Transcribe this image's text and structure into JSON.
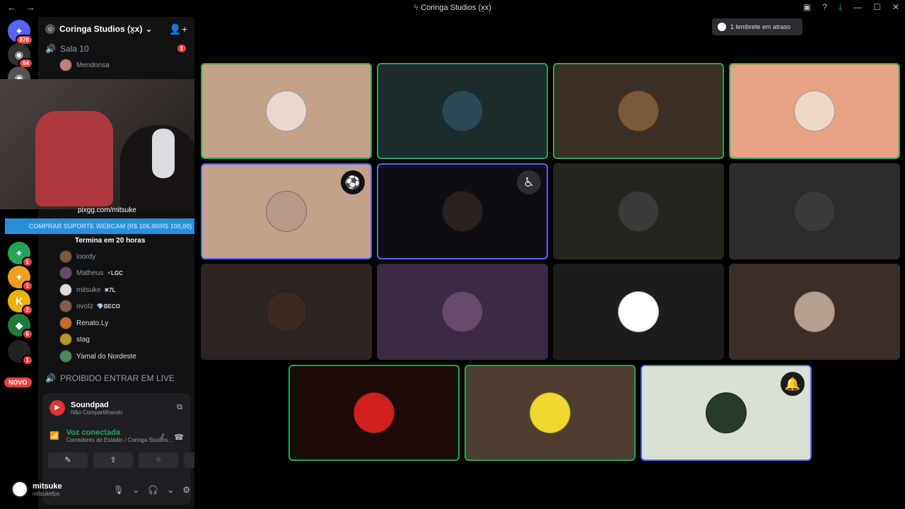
{
  "titlebar": {
    "title": "Coringa Studios (x̯x)",
    "back": "←",
    "forward": "→",
    "controls": [
      "▣",
      "?",
      "⤓",
      "—",
      "☐",
      "✕"
    ]
  },
  "servers": {
    "items": [
      {
        "icon": "discord-home-icon",
        "glyph": "✦",
        "color": "#5865f2",
        "badge": "878"
      },
      {
        "icon": "server-avatar-icon",
        "glyph": "◉",
        "color": "#333",
        "badge": "64"
      },
      {
        "icon": "server-avatar-icon",
        "glyph": "◉",
        "color": "#555",
        "badge": ""
      },
      {
        "icon": "discord-server-icon",
        "glyph": "✦",
        "color": "#23a55a",
        "badge": "1"
      },
      {
        "icon": "discord-server-icon",
        "glyph": "✦",
        "color": "#f0a020",
        "badge": "1"
      },
      {
        "icon": "k-server-icon",
        "glyph": "K",
        "color": "#e8b400",
        "badge": "2"
      },
      {
        "icon": "green-server-icon",
        "glyph": "◆",
        "color": "#1f7a3a",
        "badge": "6"
      },
      {
        "icon": "apple-server-icon",
        "glyph": "",
        "color": "#222",
        "badge": "1"
      }
    ],
    "novo": "NOVO"
  },
  "channels": {
    "guild_name": "Coringa Studios (x̯x)",
    "guild_chevron": "⌄",
    "invite_icon": "👤+",
    "voice1": {
      "name": "Sala 10",
      "count": "1"
    },
    "member_top": "Mendonsa",
    "pix": "pixgg.com/mitsuke",
    "comprar": "COMPRAR SUPORTE WEBCAM (R$ 106,00/R$ 100,00)",
    "termina": "Termina em 20 horas",
    "members": [
      {
        "name": "loordy",
        "tag": "",
        "color": "#7a5b3a",
        "hi": false
      },
      {
        "name": "Matheus",
        "tag": "⚡LGC",
        "color": "#6a4a6a",
        "hi": false
      },
      {
        "name": "mitsuke",
        "tag": "✖7L",
        "color": "#ddd",
        "hi": false
      },
      {
        "name": "ovotz",
        "tag": "💎BECO",
        "color": "#8a5a4a",
        "hi": false
      },
      {
        "name": "Renato.Ly",
        "tag": "",
        "color": "#c96a2a",
        "hi": true
      },
      {
        "name": "stag",
        "tag": "",
        "color": "#b8962a",
        "hi": true
      },
      {
        "name": "Yamal do Nordeste",
        "tag": "",
        "color": "#4a8a5a",
        "hi": true
      }
    ],
    "voice2": "PROIBIDO ENTRAR EM LIVE"
  },
  "panel": {
    "soundpad_name": "Soundpad",
    "soundpad_status": "Não Compartilhando",
    "voice_status": "Voz conectada",
    "voice_path": "Corredores do Estádio / Coringa Studios…",
    "buttons": [
      "✎",
      "⇪",
      "⁘",
      "✧"
    ]
  },
  "user": {
    "name": "mitsuke",
    "handle": "mitsukefps",
    "controls": [
      "🎙",
      "⌄",
      "🎧",
      "⌄",
      "⚙"
    ]
  },
  "reminder": "1 lembrete em atraso",
  "tiles": [
    {
      "bg": "#c4a28a",
      "border": "green",
      "avatar": "#e8d8d0",
      "overlay": ""
    },
    {
      "bg": "#1c2b2c",
      "border": "green",
      "avatar": "#2a4a55",
      "overlay": ""
    },
    {
      "bg": "#3a2f25",
      "border": "green",
      "avatar": "#7a5a3a",
      "overlay": ""
    },
    {
      "bg": "#e3a384",
      "border": "green",
      "avatar": "#f0d8c8",
      "overlay": ""
    },
    {
      "bg": "#c4a28a",
      "border": "blue",
      "avatar": "#b89a88",
      "overlay": "⚽"
    },
    {
      "bg": "#0f0d12",
      "border": "blue",
      "avatar": "#2a2220",
      "overlay": "♿"
    },
    {
      "bg": "#23251f",
      "border": "",
      "avatar": "#3a3a3a",
      "overlay": ""
    },
    {
      "bg": "#2b2d2b",
      "border": "",
      "avatar": "#3a3a3a",
      "overlay": ""
    },
    {
      "bg": "#2d2522",
      "border": "",
      "avatar": "#3a2a22",
      "overlay": ""
    },
    {
      "bg": "#3a2b42",
      "border": "",
      "avatar": "#6a4a6a",
      "overlay": ""
    },
    {
      "bg": "#1b1c1e",
      "border": "",
      "avatar": "#ffffff",
      "overlay": ""
    },
    {
      "bg": "#3b2e28",
      "border": "",
      "avatar": "#b8a090",
      "overlay": ""
    },
    {
      "bg": "#1d0b09",
      "border": "green",
      "avatar": "#d02020",
      "overlay": ""
    },
    {
      "bg": "#4e3e30",
      "border": "green",
      "avatar": "#f0d830",
      "overlay": ""
    },
    {
      "bg": "#d9e1d6",
      "border": "blue",
      "avatar": "#2a3a2a",
      "overlay": "🔔"
    }
  ]
}
